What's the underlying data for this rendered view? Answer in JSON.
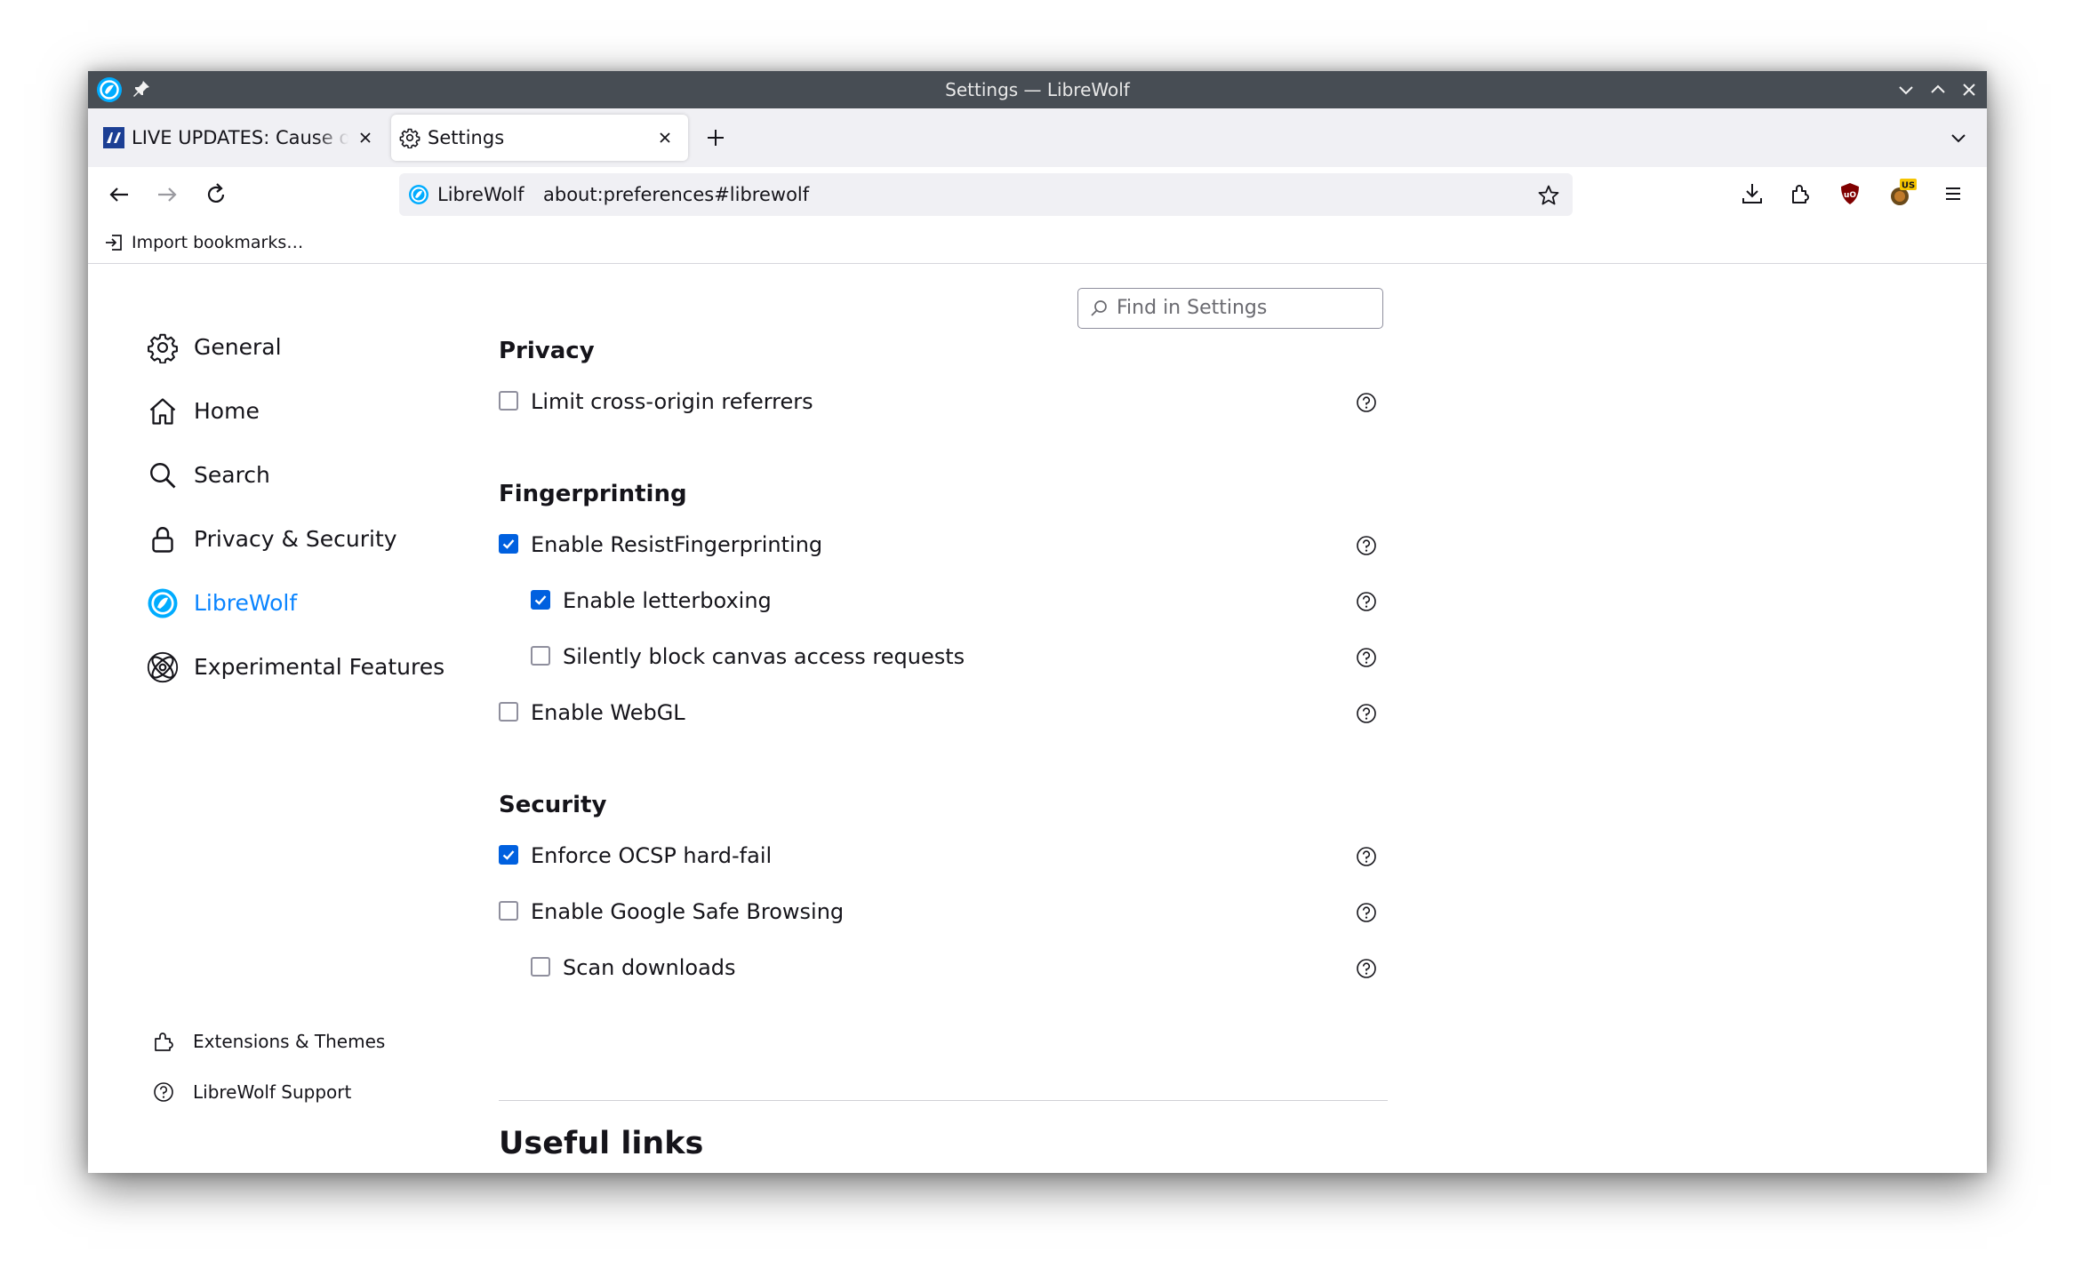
{
  "window": {
    "title": "Settings — LibreWolf"
  },
  "colors": {
    "accent": "#0a84ff",
    "checkbox": "#0060df",
    "titlebar": "#474d54"
  },
  "tabs": [
    {
      "label": "LIVE UPDATES: Cause of Colonial Pipeline shutdown",
      "favicon": "news-favicon-icon",
      "active": false
    },
    {
      "label": "Settings",
      "favicon": "gear-icon",
      "active": true
    }
  ],
  "urlbar": {
    "identity": "LibreWolf",
    "url": "about:preferences#librewolf"
  },
  "bookmarks": {
    "import_label": "Import bookmarks…"
  },
  "toolbar": {
    "ublock_label": "uO",
    "container_badge": "US"
  },
  "search": {
    "placeholder": "Find in Settings"
  },
  "sidebar": {
    "items": [
      {
        "label": "General",
        "icon": "gear-icon"
      },
      {
        "label": "Home",
        "icon": "home-icon"
      },
      {
        "label": "Search",
        "icon": "search-icon"
      },
      {
        "label": "Privacy & Security",
        "icon": "lock-icon"
      },
      {
        "label": "LibreWolf",
        "icon": "librewolf-icon",
        "selected": true
      },
      {
        "label": "Experimental Features",
        "icon": "atom-icon"
      }
    ],
    "footer": [
      {
        "label": "Extensions & Themes",
        "icon": "puzzle-icon"
      },
      {
        "label": "LibreWolf Support",
        "icon": "help-icon"
      }
    ]
  },
  "sections": {
    "privacy": {
      "title": "Privacy",
      "options": [
        {
          "label": "Limit cross-origin referrers",
          "checked": false
        }
      ]
    },
    "fingerprinting": {
      "title": "Fingerprinting",
      "options": [
        {
          "label": "Enable ResistFingerprinting",
          "checked": true
        },
        {
          "label": "Enable letterboxing",
          "checked": true
        },
        {
          "label": "Silently block canvas access requests",
          "checked": false
        },
        {
          "label": "Enable WebGL",
          "checked": false
        }
      ]
    },
    "security": {
      "title": "Security",
      "options": [
        {
          "label": "Enforce OCSP hard-fail",
          "checked": true
        },
        {
          "label": "Enable Google Safe Browsing",
          "checked": false
        },
        {
          "label": "Scan downloads",
          "checked": false
        }
      ]
    },
    "useful_links": {
      "title": "Useful links"
    }
  }
}
